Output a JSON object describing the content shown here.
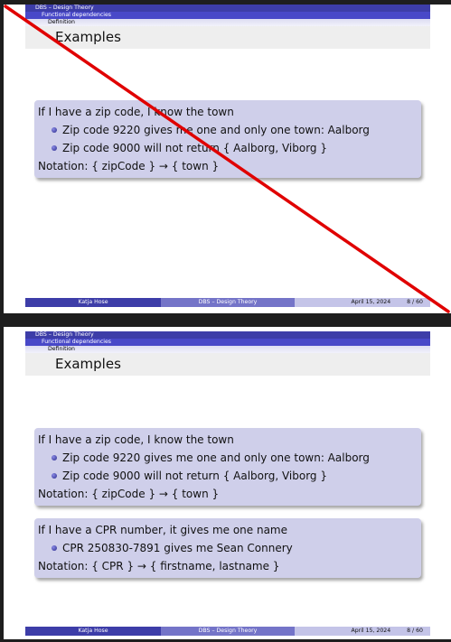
{
  "header": {
    "section": "DBS – Design Theory",
    "subsection": "Functional dependencies",
    "subsubsection": "Definition"
  },
  "frame_title": "Examples",
  "block1": {
    "intro": "If I have a zip code, I know the town",
    "items": [
      "Zip code 9220 gives me one and only one town: Aalborg",
      "Zip code 9000 will not return { Aalborg, Viborg }"
    ],
    "notation": "Notation: { zipCode } → { town }"
  },
  "block2": {
    "intro": "If I have a CPR number, it gives me one name",
    "items": [
      "CPR 250830-7891 gives me Sean Connery"
    ],
    "notation": "Notation: { CPR } → { firstname, lastname }"
  },
  "footer": {
    "author": "Katja Hose",
    "title": "DBS – Design Theory",
    "date": "April 15, 2024",
    "page": "8 / 60"
  },
  "colors": {
    "header_dark": "#3d3da8",
    "header_mid": "#4848c8",
    "block_bg": "#cfcfea",
    "annotation_red": "#e00000"
  }
}
